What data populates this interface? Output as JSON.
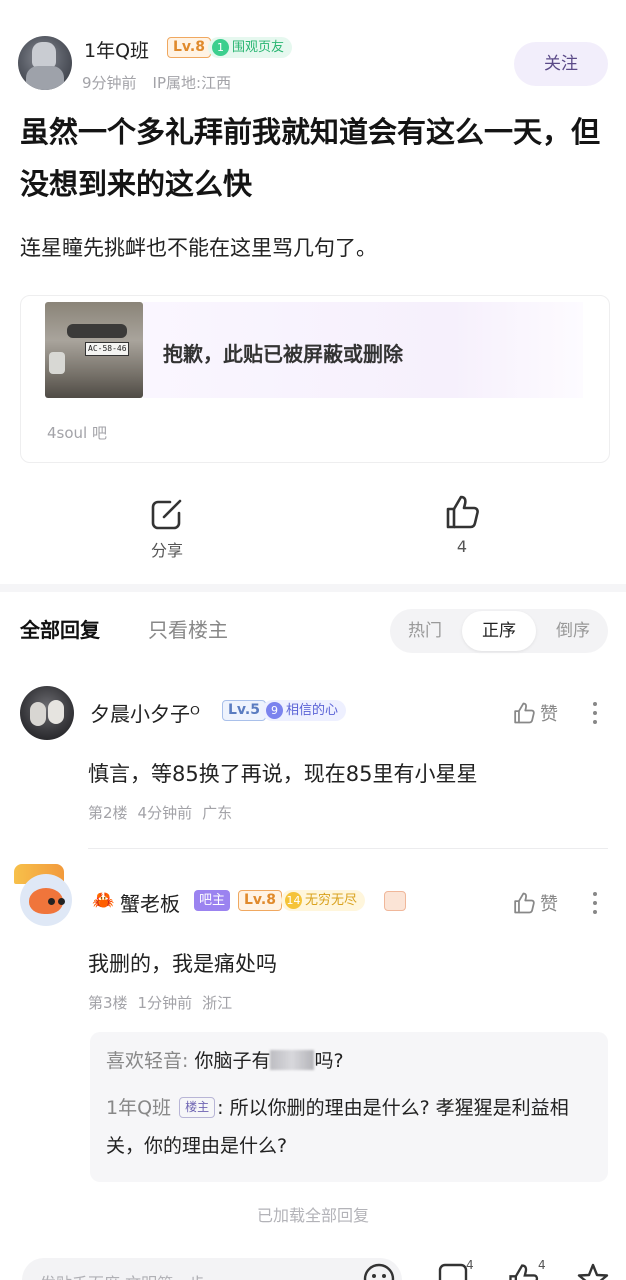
{
  "post": {
    "author": {
      "name": "1年Q班",
      "level": "Lv.8",
      "honor_num": "1",
      "honor_title": "围观页友",
      "time": "9分钟前",
      "ip": "IP属地:江西"
    },
    "follow_label": "关注",
    "title": "虽然一个多礼拜前我就知道会有这么一天，但没想到来的这么快",
    "body": "连星瞳先挑衅也不能在这里骂几句了。",
    "quote": {
      "text": "抱歉，此贴已被屏蔽或删除",
      "forum": "4soul 吧",
      "plate": "AC-58-46"
    },
    "share_label": "分享",
    "like_count": "4"
  },
  "tabs": {
    "all": "全部回复",
    "op_only": "只看楼主",
    "sort": [
      "热门",
      "正序",
      "倒序"
    ],
    "active_sort": "正序"
  },
  "replies": [
    {
      "name": "夕晨小夕子ᴼ",
      "level": "Lv.5",
      "honor_num": "9",
      "honor_title": "相信的心",
      "like_label": "赞",
      "text": "慎言，等85换了再说，现在85里有小星星",
      "floor": "第2楼",
      "time": "4分钟前",
      "location": "广东"
    },
    {
      "name": "蟹老板",
      "role": "吧主",
      "level": "Lv.8",
      "honor_num": "14",
      "honor_title": "无穷无尽",
      "like_label": "赞",
      "text": "我删的，我是痛处吗",
      "floor": "第3楼",
      "time": "1分钟前",
      "location": "浙江",
      "sub_replies": [
        {
          "author": "喜欢轻音:",
          "text_before": "你脑子有",
          "text_after": "吗?"
        },
        {
          "author": "1年Q班",
          "tag": "楼主",
          "text": "所以你删的理由是什么? 孝猩猩是利益相关，你的理由是什么?"
        }
      ]
    }
  ],
  "loaded_all": "已加载全部回复",
  "bottom_bar": {
    "placeholder": "发贴千百度 文明第一步",
    "comment_count": "4",
    "like_count": "4"
  },
  "colors": {
    "accent_purple": "#5b4a88",
    "level_orange": "#e08a2c",
    "honor_green": "#2bb673"
  }
}
